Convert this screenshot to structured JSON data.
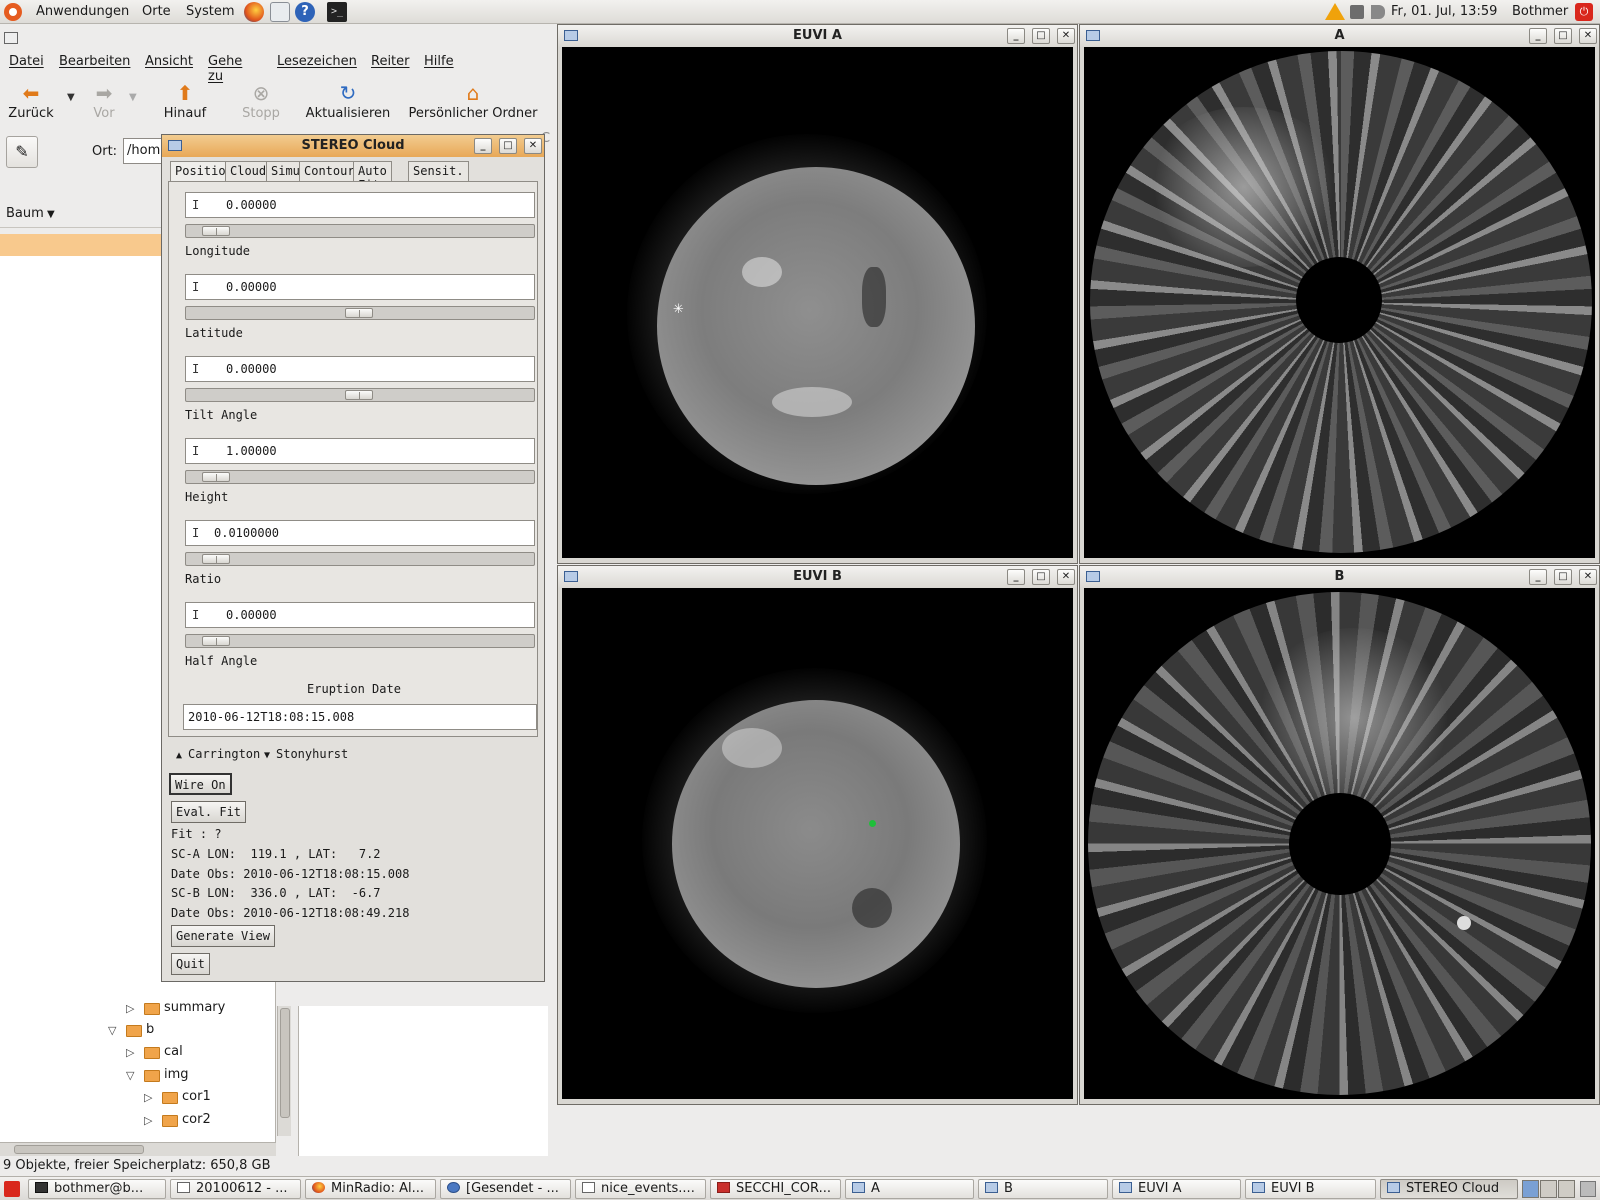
{
  "top_panel": {
    "menus": [
      "Anwendungen",
      "Orte",
      "System"
    ],
    "clock": "Fr, 01. Jul, 13:59",
    "user": "Bothmer",
    "icons": [
      "firefox-icon",
      "mail-icon",
      "help-icon",
      "terminal-icon",
      "warning-icon",
      "network-icon",
      "volume-icon",
      "power-icon"
    ]
  },
  "nautilus": {
    "menu": [
      "Datei",
      "Bearbeiten",
      "Ansicht",
      "Gehe zu",
      "Lesezeichen",
      "Reiter",
      "Hilfe"
    ],
    "toolbar": {
      "back": "Zurück",
      "forward": "Vor",
      "up": "Hinauf",
      "stop": "Stopp",
      "reload": "Aktualisieren",
      "home": "Persönlicher Ordner",
      "cut_off": "C"
    },
    "location_label": "Ort:",
    "location_value": "/hom",
    "sidepane_mode": "Baum",
    "tree": [
      "summary",
      "b",
      "cal",
      "img",
      "cor1",
      "cor2"
    ],
    "status": "9 Objekte, freier Speicherplatz: 650,8 GB"
  },
  "stereo": {
    "title": "STEREO Cloud",
    "tabs": [
      "Position",
      "Cloud",
      "Simu",
      "Contour",
      "Auto Fit",
      "Sensit."
    ],
    "fields": [
      {
        "value": "0.00000",
        "label": "Longitude",
        "slider": 0.05
      },
      {
        "value": "0.00000",
        "label": "Latitude",
        "slider": 0.5
      },
      {
        "value": "0.00000",
        "label": "Tilt Angle",
        "slider": 0.5
      },
      {
        "value": "1.00000",
        "label": "Height",
        "slider": 0.05
      },
      {
        "value": "0.0100000",
        "label": "Ratio",
        "slider": 0.05
      },
      {
        "value": "0.00000",
        "label": "Half Angle",
        "slider": 0.05
      }
    ],
    "eruption_label": "Eruption Date",
    "eruption_date": "2010-06-12T18:08:15.008",
    "radio_carrington": "Carrington",
    "radio_stonyhurst": "Stonyhurst",
    "btn_wire": "Wire On",
    "btn_eval": "Eval. Fit",
    "fit_line": "Fit : ?",
    "sca_line": "SC-A LON:  119.1 , LAT:   7.2",
    "date_a": "Date Obs: 2010-06-12T18:08:15.008",
    "scb_line": "SC-B LON:  336.0 , LAT:  -6.7",
    "date_b": "Date Obs: 2010-06-12T18:08:49.218",
    "btn_generate": "Generate View",
    "btn_quit": "Quit"
  },
  "windows": {
    "euvi_a": "EUVI A",
    "cor_a": "A",
    "euvi_b": "EUVI B",
    "cor_b": "B"
  },
  "taskbar": [
    {
      "label": "bothmer@b...",
      "icon": "term"
    },
    {
      "label": "20100612 - ...",
      "icon": "doc"
    },
    {
      "label": "MinRadio: Al...",
      "icon": "ff"
    },
    {
      "label": "[Gesendet - ...",
      "icon": "chat"
    },
    {
      "label": "nice_events....",
      "icon": "doc"
    },
    {
      "label": "SECCHI_COR...",
      "icon": "pdf"
    },
    {
      "label": "A",
      "icon": "win"
    },
    {
      "label": "B",
      "icon": "win"
    },
    {
      "label": "EUVI A",
      "icon": "win"
    },
    {
      "label": "EUVI B",
      "icon": "win"
    },
    {
      "label": "STEREO Cloud",
      "icon": "win"
    }
  ]
}
